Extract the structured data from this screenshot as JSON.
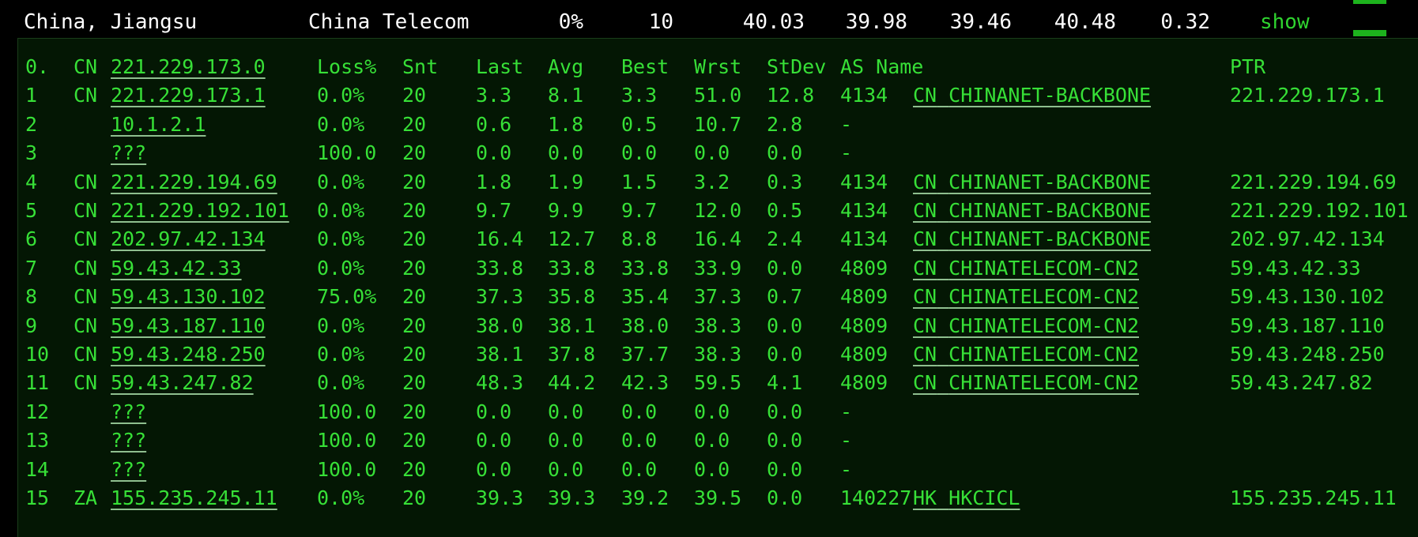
{
  "summary": {
    "location": "China, Jiangsu",
    "isp": "China Telecom",
    "loss": "0%",
    "sent": "10",
    "last": "40.03",
    "avg": "39.98",
    "best": "39.46",
    "worst": "40.48",
    "stdev": "0.32",
    "show_label": "show"
  },
  "header": {
    "hop": "0.",
    "cc": "CN",
    "host": "221.229.173.0",
    "loss": "Loss%",
    "snt": "Snt",
    "last": "Last",
    "avg": "Avg",
    "best": "Best",
    "wrst": "Wrst",
    "stdev": "StDev",
    "as_name": "AS Name",
    "ptr": "PTR"
  },
  "hops": [
    {
      "hop": "1",
      "cc": "CN",
      "host": "221.229.173.1",
      "loss": "0.0%",
      "snt": "20",
      "last": "3.3",
      "avg": "8.1",
      "best": "3.3",
      "wrst": "51.0",
      "stdev": "12.8",
      "asn": "4134",
      "as_cc": "CN",
      "as_name": "CHINANET-BACKBONE",
      "ptr": "221.229.173.1"
    },
    {
      "hop": "2",
      "cc": "",
      "host": "10.1.2.1",
      "loss": "0.0%",
      "snt": "20",
      "last": "0.6",
      "avg": "1.8",
      "best": "0.5",
      "wrst": "10.7",
      "stdev": "2.8",
      "as_dash": "-",
      "ptr": ""
    },
    {
      "hop": "3",
      "cc": "",
      "host": "???",
      "loss": "100.0",
      "snt": "20",
      "last": "0.0",
      "avg": "0.0",
      "best": "0.0",
      "wrst": "0.0",
      "stdev": "0.0",
      "as_dash": "-",
      "ptr": ""
    },
    {
      "hop": "4",
      "cc": "CN",
      "host": "221.229.194.69",
      "loss": "0.0%",
      "snt": "20",
      "last": "1.8",
      "avg": "1.9",
      "best": "1.5",
      "wrst": "3.2",
      "stdev": "0.3",
      "asn": "4134",
      "as_cc": "CN",
      "as_name": "CHINANET-BACKBONE",
      "ptr": "221.229.194.69"
    },
    {
      "hop": "5",
      "cc": "CN",
      "host": "221.229.192.101",
      "loss": "0.0%",
      "snt": "20",
      "last": "9.7",
      "avg": "9.9",
      "best": "9.7",
      "wrst": "12.0",
      "stdev": "0.5",
      "asn": "4134",
      "as_cc": "CN",
      "as_name": "CHINANET-BACKBONE",
      "ptr": "221.229.192.101"
    },
    {
      "hop": "6",
      "cc": "CN",
      "host": "202.97.42.134",
      "loss": "0.0%",
      "snt": "20",
      "last": "16.4",
      "avg": "12.7",
      "best": "8.8",
      "wrst": "16.4",
      "stdev": "2.4",
      "asn": "4134",
      "as_cc": "CN",
      "as_name": "CHINANET-BACKBONE",
      "ptr": "202.97.42.134"
    },
    {
      "hop": "7",
      "cc": "CN",
      "host": "59.43.42.33",
      "loss": "0.0%",
      "snt": "20",
      "last": "33.8",
      "avg": "33.8",
      "best": "33.8",
      "wrst": "33.9",
      "stdev": "0.0",
      "asn": "4809",
      "as_cc": "CN",
      "as_name": "CHINATELECOM-CN2",
      "ptr": "59.43.42.33"
    },
    {
      "hop": "8",
      "cc": "CN",
      "host": "59.43.130.102",
      "loss": "75.0%",
      "snt": "20",
      "last": "37.3",
      "avg": "35.8",
      "best": "35.4",
      "wrst": "37.3",
      "stdev": "0.7",
      "asn": "4809",
      "as_cc": "CN",
      "as_name": "CHINATELECOM-CN2",
      "ptr": "59.43.130.102"
    },
    {
      "hop": "9",
      "cc": "CN",
      "host": "59.43.187.110",
      "loss": "0.0%",
      "snt": "20",
      "last": "38.0",
      "avg": "38.1",
      "best": "38.0",
      "wrst": "38.3",
      "stdev": "0.0",
      "asn": "4809",
      "as_cc": "CN",
      "as_name": "CHINATELECOM-CN2",
      "ptr": "59.43.187.110"
    },
    {
      "hop": "10",
      "cc": "CN",
      "host": "59.43.248.250",
      "loss": "0.0%",
      "snt": "20",
      "last": "38.1",
      "avg": "37.8",
      "best": "37.7",
      "wrst": "38.3",
      "stdev": "0.0",
      "asn": "4809",
      "as_cc": "CN",
      "as_name": "CHINATELECOM-CN2",
      "ptr": "59.43.248.250"
    },
    {
      "hop": "11",
      "cc": "CN",
      "host": "59.43.247.82",
      "loss": "0.0%",
      "snt": "20",
      "last": "48.3",
      "avg": "44.2",
      "best": "42.3",
      "wrst": "59.5",
      "stdev": "4.1",
      "asn": "4809",
      "as_cc": "CN",
      "as_name": "CHINATELECOM-CN2",
      "ptr": "59.43.247.82"
    },
    {
      "hop": "12",
      "cc": "",
      "host": "???",
      "loss": "100.0",
      "snt": "20",
      "last": "0.0",
      "avg": "0.0",
      "best": "0.0",
      "wrst": "0.0",
      "stdev": "0.0",
      "as_dash": "-",
      "ptr": ""
    },
    {
      "hop": "13",
      "cc": "",
      "host": "???",
      "loss": "100.0",
      "snt": "20",
      "last": "0.0",
      "avg": "0.0",
      "best": "0.0",
      "wrst": "0.0",
      "stdev": "0.0",
      "as_dash": "-",
      "ptr": ""
    },
    {
      "hop": "14",
      "cc": "",
      "host": "???",
      "loss": "100.0",
      "snt": "20",
      "last": "0.0",
      "avg": "0.0",
      "best": "0.0",
      "wrst": "0.0",
      "stdev": "0.0",
      "as_dash": "-",
      "ptr": ""
    },
    {
      "hop": "15",
      "cc": "ZA",
      "host": "155.235.245.11",
      "loss": "0.0%",
      "snt": "20",
      "last": "39.3",
      "avg": "39.3",
      "best": "39.2",
      "wrst": "39.5",
      "stdev": "0.0",
      "asn": "140227",
      "as_cc": "HK",
      "as_name": "HKCICL",
      "ptr": "155.235.245.11"
    }
  ],
  "colors": {
    "terminal_bg": "#041704",
    "terminal_text": "#37e037",
    "summary_text": "#ffffff",
    "show_link": "#2fd42f"
  }
}
